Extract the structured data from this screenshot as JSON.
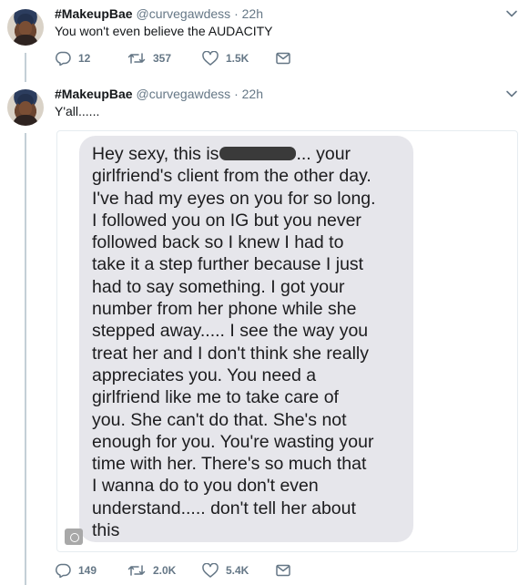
{
  "tweets": [
    {
      "display_name": "#MakeupBae",
      "handle": "@curvegawdess",
      "separator": "·",
      "time": "22h",
      "text": "You won't even believe the AUDACITY",
      "replies": "12",
      "retweets": "357",
      "likes": "1.5K"
    },
    {
      "display_name": "#MakeupBae",
      "handle": "@curvegawdess",
      "separator": "·",
      "time": "22h",
      "text": "Y'all......",
      "replies": "149",
      "retweets": "2.0K",
      "likes": "5.4K"
    }
  ],
  "message": {
    "lines": [
      "Hey sexy, this is",
      "... your",
      "girlfriend's client from the other day.",
      "I've had my eyes on you for so long.",
      "I followed you on IG but you never",
      "followed back so I knew I had to",
      "take it a step further because I just",
      "had to say something. I got your",
      "number from her phone while she",
      "stepped away..... I see the way you",
      "treat her and I don't think she really",
      "appreciates you. You need a",
      "girlfriend like me to take care of",
      "you. She can't do that. She's not",
      "enough for you. You're wasting your",
      "time with her. There's so much that",
      "I wanna do to you don't even",
      "understand..... don't tell her about",
      "this"
    ]
  },
  "colors": {
    "text": "#14171a",
    "secondary": "#657786",
    "thread_line": "#c4cfd6",
    "bubble": "#e6e6eb"
  },
  "icons": [
    "chevron-down-icon",
    "reply-icon",
    "retweet-icon",
    "like-icon",
    "direct-message-icon",
    "media-badge-icon"
  ]
}
